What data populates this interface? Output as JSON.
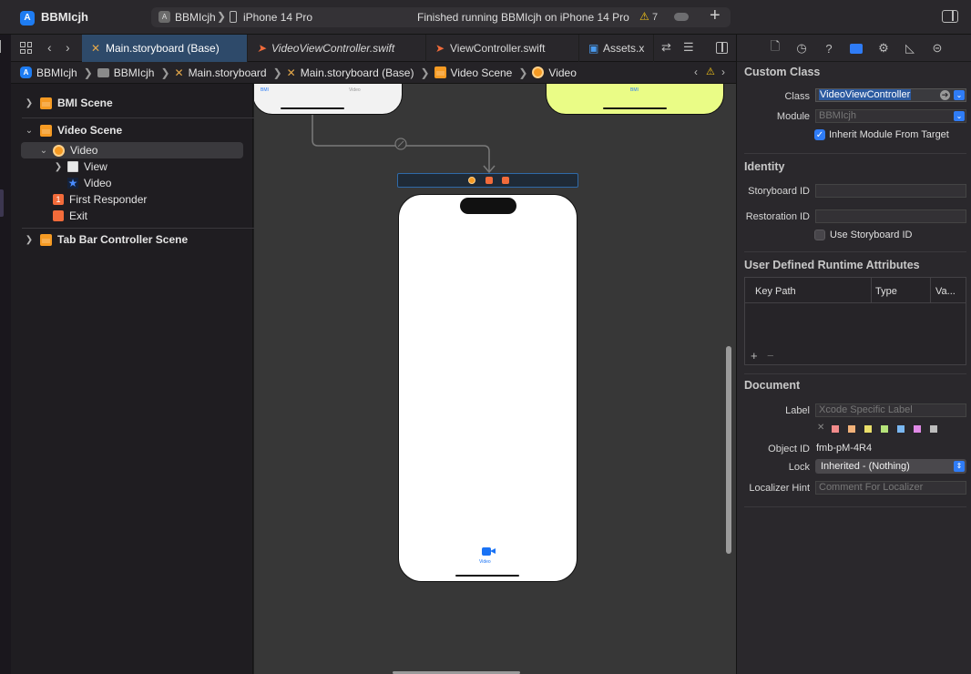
{
  "toolbar": {
    "app_name": "BBMIcjh",
    "scheme": "BBMIcjh",
    "device": "iPhone 14 Pro",
    "status": "Finished running BBMIcjh on iPhone 14 Pro",
    "warnings": "7",
    "add_icon": "plus-icon",
    "inspector_toggle_icon": "sidebar-right-icon"
  },
  "tabs": [
    {
      "label": "Main.storyboard (Base)",
      "icon": "storyboard-icon",
      "active": true
    },
    {
      "label": "VideoViewController.swift",
      "icon": "swift-icon",
      "active": false
    },
    {
      "label": "ViewController.swift",
      "icon": "swift-icon",
      "active": false
    },
    {
      "label": "Assets.x",
      "icon": "assets-icon",
      "active": false
    }
  ],
  "breadcrumb": [
    {
      "label": "BBMIcjh",
      "icon": "app-icon"
    },
    {
      "label": "BBMIcjh",
      "icon": "folder-icon"
    },
    {
      "label": "Main.storyboard",
      "icon": "storyboard-icon"
    },
    {
      "label": "Main.storyboard (Base)",
      "icon": "storyboard-icon"
    },
    {
      "label": "Video Scene",
      "icon": "scene-icon"
    },
    {
      "label": "Video",
      "icon": "view-controller-icon"
    }
  ],
  "outline": {
    "bmi_scene": "BMI Scene",
    "video_scene": "Video Scene",
    "video_vc": "Video",
    "view": "View",
    "video_item": "Video",
    "first_responder": "First Responder",
    "exit": "Exit",
    "tab_bar_scene": "Tab Bar Controller Scene"
  },
  "canvas": {
    "tab_item_label": "Video",
    "top_left_tab_1": "BMI",
    "top_left_tab_2": "Video",
    "top_right_tab": "BMI"
  },
  "inspector": {
    "custom_class": {
      "title": "Custom Class",
      "class_label": "Class",
      "class_value": "VideoViewController",
      "module_label": "Module",
      "module_placeholder": "BBMIcjh",
      "inherit_label": "Inherit Module From Target",
      "inherit_checked": true
    },
    "identity": {
      "title": "Identity",
      "storyboard_id_label": "Storyboard ID",
      "restoration_id_label": "Restoration ID",
      "use_storyboard_id_label": "Use Storyboard ID",
      "use_storyboard_id_checked": false
    },
    "runtime_attrs": {
      "title": "User Defined Runtime Attributes",
      "columns": [
        "Key Path",
        "Type",
        "Va..."
      ],
      "add": "+",
      "remove": "−"
    },
    "document": {
      "title": "Document",
      "label_label": "Label",
      "label_placeholder": "Xcode Specific Label",
      "colors": [
        "#f28b8b",
        "#f2b27a",
        "#eadf6a",
        "#b5e37a",
        "#7ab8f2",
        "#e08ae6",
        "#bdbdbd"
      ],
      "object_id_label": "Object ID",
      "object_id_value": "fmb-pM-4R4",
      "lock_label": "Lock",
      "lock_value": "Inherited - (Nothing)",
      "localizer_label": "Localizer Hint",
      "localizer_placeholder": "Comment For Localizer"
    }
  }
}
